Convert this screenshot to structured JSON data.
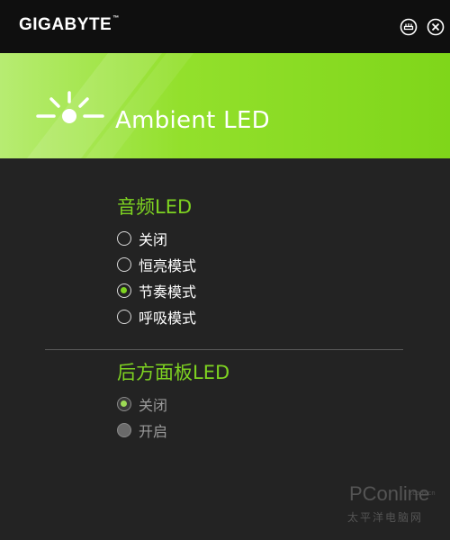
{
  "window": {
    "brand": "GIGABYTE",
    "brand_mark": "™",
    "settings_icon": "settings-icon",
    "close_icon": "close-icon"
  },
  "banner": {
    "title": "Ambient LED",
    "icon": "light-burst-icon",
    "accent_color": "#7ed321"
  },
  "audio_led": {
    "title": "音频LED",
    "options": [
      {
        "label": "关闭",
        "checked": false
      },
      {
        "label": "恒亮模式",
        "checked": false
      },
      {
        "label": "节奏模式",
        "checked": true
      },
      {
        "label": "呼吸模式",
        "checked": false
      }
    ]
  },
  "rear_panel_led": {
    "title": "后方面板LED",
    "options": [
      {
        "label": "关闭",
        "checked": true,
        "disabled": true
      },
      {
        "label": "开启",
        "checked": false,
        "disabled": true
      }
    ]
  },
  "watermark": {
    "brand": "PConline",
    "domain": ".com.cn",
    "subtitle": "太平洋电脑网"
  }
}
